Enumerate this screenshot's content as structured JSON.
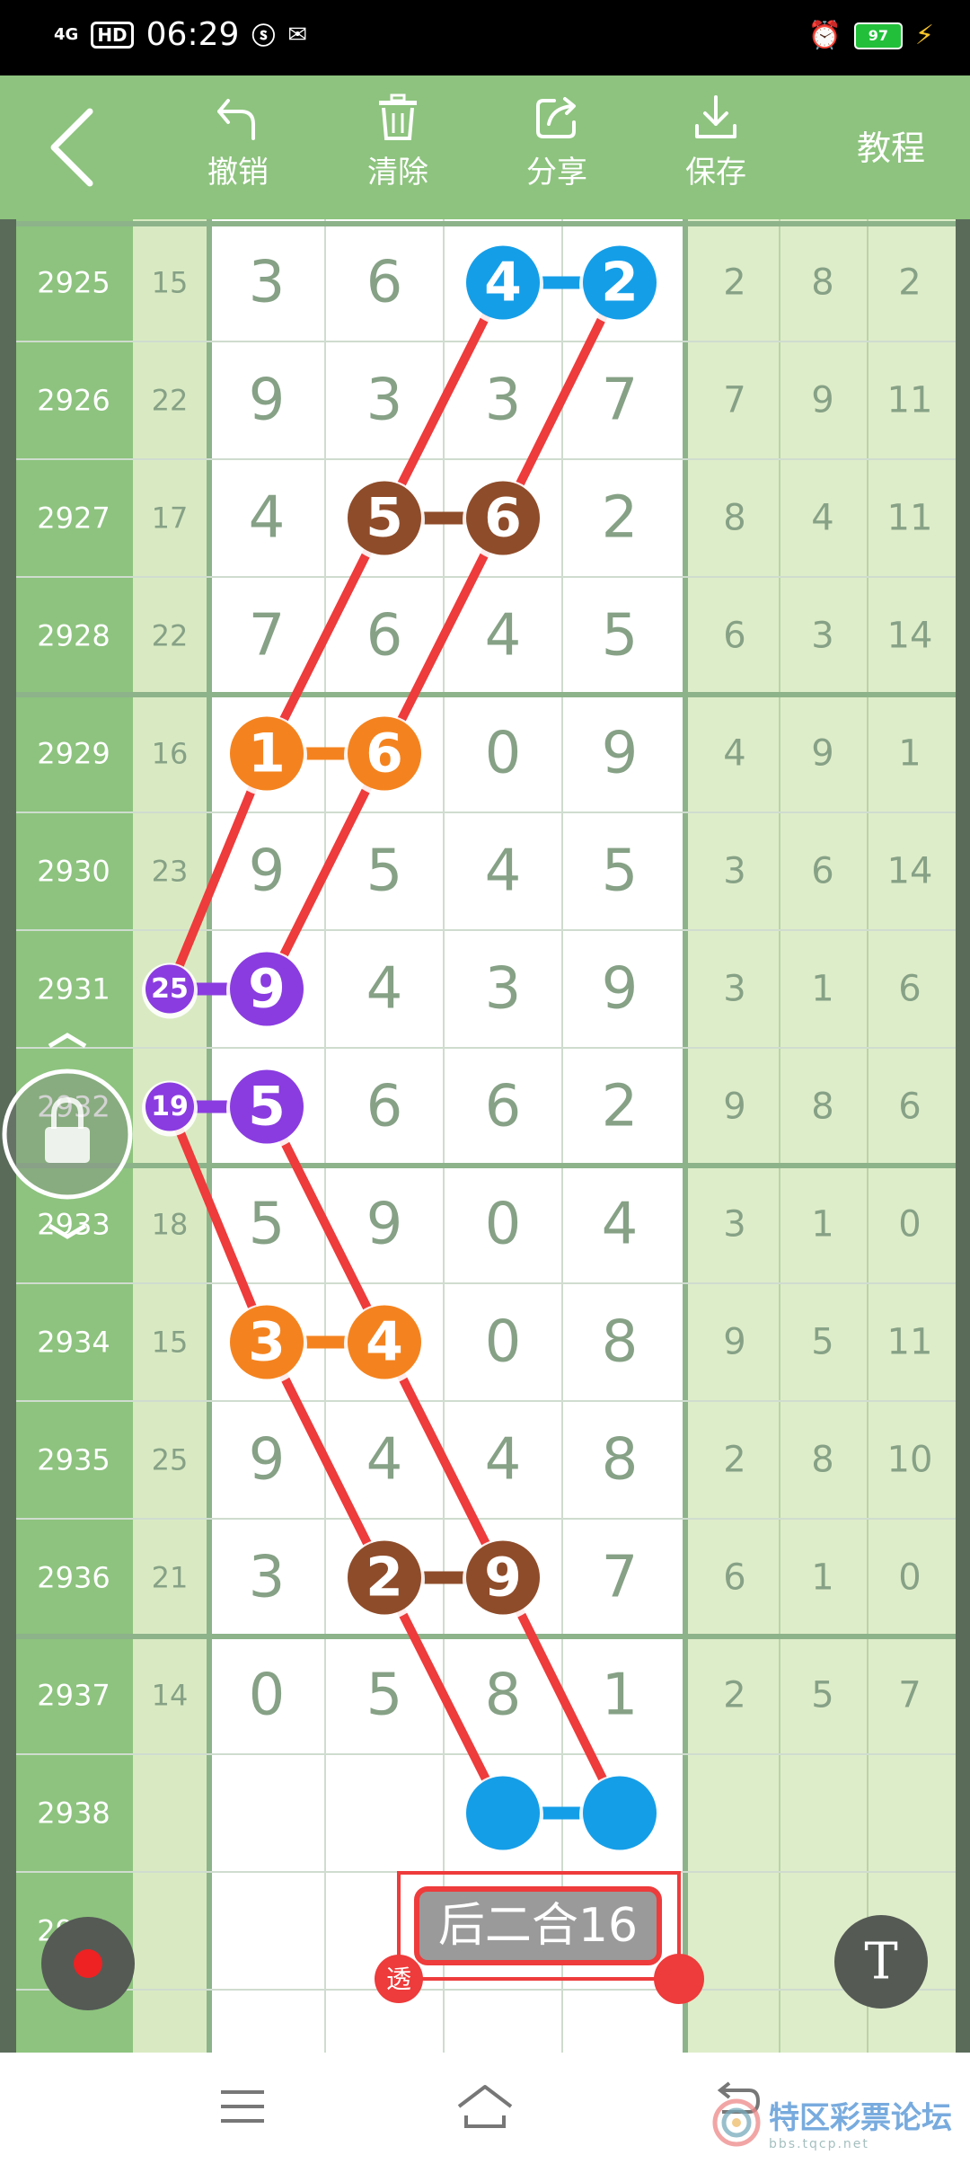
{
  "status_bar": {
    "network": "4G",
    "hd": "HD",
    "time": "06:29",
    "battery": "97"
  },
  "toolbar": {
    "back_icon": "chevron-left-icon",
    "buttons": [
      {
        "label": "撤销",
        "icon": "undo-icon"
      },
      {
        "label": "清除",
        "icon": "trash-icon"
      },
      {
        "label": "分享",
        "icon": "share-icon"
      },
      {
        "label": "保存",
        "icon": "download-icon"
      }
    ],
    "tutorial": "教程"
  },
  "colors": {
    "id_col": "#8dc37e",
    "sum_col": "#d9eac2",
    "right_col": "#deedc9",
    "grid_line": "#8db38a",
    "digit_text": "#86a186",
    "line_red": "#ee3b3b",
    "blue": "#159ee8",
    "brown": "#8f4c2a",
    "orange": "#f4831f",
    "purple": "#8a3ce0"
  },
  "table": {
    "rows": [
      {
        "id": "2925",
        "sum": "15",
        "digits": [
          "3",
          "6",
          "4",
          "2"
        ],
        "right": [
          "2",
          "8",
          "2"
        ]
      },
      {
        "id": "2926",
        "sum": "22",
        "digits": [
          "9",
          "3",
          "3",
          "7"
        ],
        "right": [
          "7",
          "9",
          "11"
        ]
      },
      {
        "id": "2927",
        "sum": "17",
        "digits": [
          "4",
          "5",
          "6",
          "2"
        ],
        "right": [
          "8",
          "4",
          "11"
        ]
      },
      {
        "id": "2928",
        "sum": "22",
        "digits": [
          "7",
          "6",
          "4",
          "5"
        ],
        "right": [
          "6",
          "3",
          "14"
        ]
      },
      {
        "id": "2929",
        "sum": "16",
        "digits": [
          "1",
          "6",
          "0",
          "9"
        ],
        "right": [
          "4",
          "9",
          "1"
        ]
      },
      {
        "id": "2930",
        "sum": "23",
        "digits": [
          "9",
          "5",
          "4",
          "5"
        ],
        "right": [
          "3",
          "6",
          "14"
        ]
      },
      {
        "id": "2931",
        "sum": "25",
        "digits": [
          "9",
          "4",
          "3",
          "9"
        ],
        "right": [
          "3",
          "1",
          "6"
        ]
      },
      {
        "id": "2932",
        "sum": "19",
        "digits": [
          "5",
          "6",
          "6",
          "2"
        ],
        "right": [
          "9",
          "8",
          "6"
        ]
      },
      {
        "id": "2933",
        "sum": "18",
        "digits": [
          "5",
          "9",
          "0",
          "4"
        ],
        "right": [
          "3",
          "1",
          "0"
        ]
      },
      {
        "id": "2934",
        "sum": "15",
        "digits": [
          "3",
          "4",
          "0",
          "8"
        ],
        "right": [
          "9",
          "5",
          "11"
        ]
      },
      {
        "id": "2935",
        "sum": "25",
        "digits": [
          "9",
          "4",
          "4",
          "8"
        ],
        "right": [
          "2",
          "8",
          "10"
        ]
      },
      {
        "id": "2936",
        "sum": "21",
        "digits": [
          "3",
          "2",
          "9",
          "7"
        ],
        "right": [
          "6",
          "1",
          "0"
        ]
      },
      {
        "id": "2937",
        "sum": "14",
        "digits": [
          "0",
          "5",
          "8",
          "1"
        ],
        "right": [
          "2",
          "5",
          "7"
        ]
      },
      {
        "id": "2938",
        "sum": "",
        "digits": [
          "",
          "",
          "",
          ""
        ],
        "right": [
          "",
          "",
          ""
        ]
      },
      {
        "id": "2939",
        "sum": "",
        "digits": [
          "",
          "",
          "",
          ""
        ],
        "right": [
          "",
          "",
          ""
        ]
      }
    ],
    "markers": [
      {
        "row": 0,
        "cols": [
          2,
          3
        ],
        "color": "blue"
      },
      {
        "row": 2,
        "cols": [
          1,
          2
        ],
        "color": "brown"
      },
      {
        "row": 4,
        "cols": [
          0,
          1
        ],
        "color": "orange"
      },
      {
        "row": 6,
        "cols": [
          "sum",
          0
        ],
        "color": "purple"
      },
      {
        "row": 7,
        "cols": [
          "sum",
          0
        ],
        "color": "purple"
      },
      {
        "row": 9,
        "cols": [
          0,
          1
        ],
        "color": "orange"
      },
      {
        "row": 11,
        "cols": [
          1,
          2
        ],
        "color": "brown"
      },
      {
        "row": 13,
        "cols": [
          2,
          3
        ],
        "color": "blue"
      }
    ]
  },
  "annotation": {
    "label": "后二合16",
    "badge": "透"
  },
  "floating": {
    "lock_icon": "lock-icon",
    "record_icon": "record-icon",
    "text_tool": "T"
  },
  "nav": {
    "menu_icon": "menu-icon",
    "home_icon": "home-icon",
    "back_icon": "back-icon"
  },
  "watermark": {
    "text": "特区彩票论坛",
    "url": "bbs.tqcp.net"
  }
}
